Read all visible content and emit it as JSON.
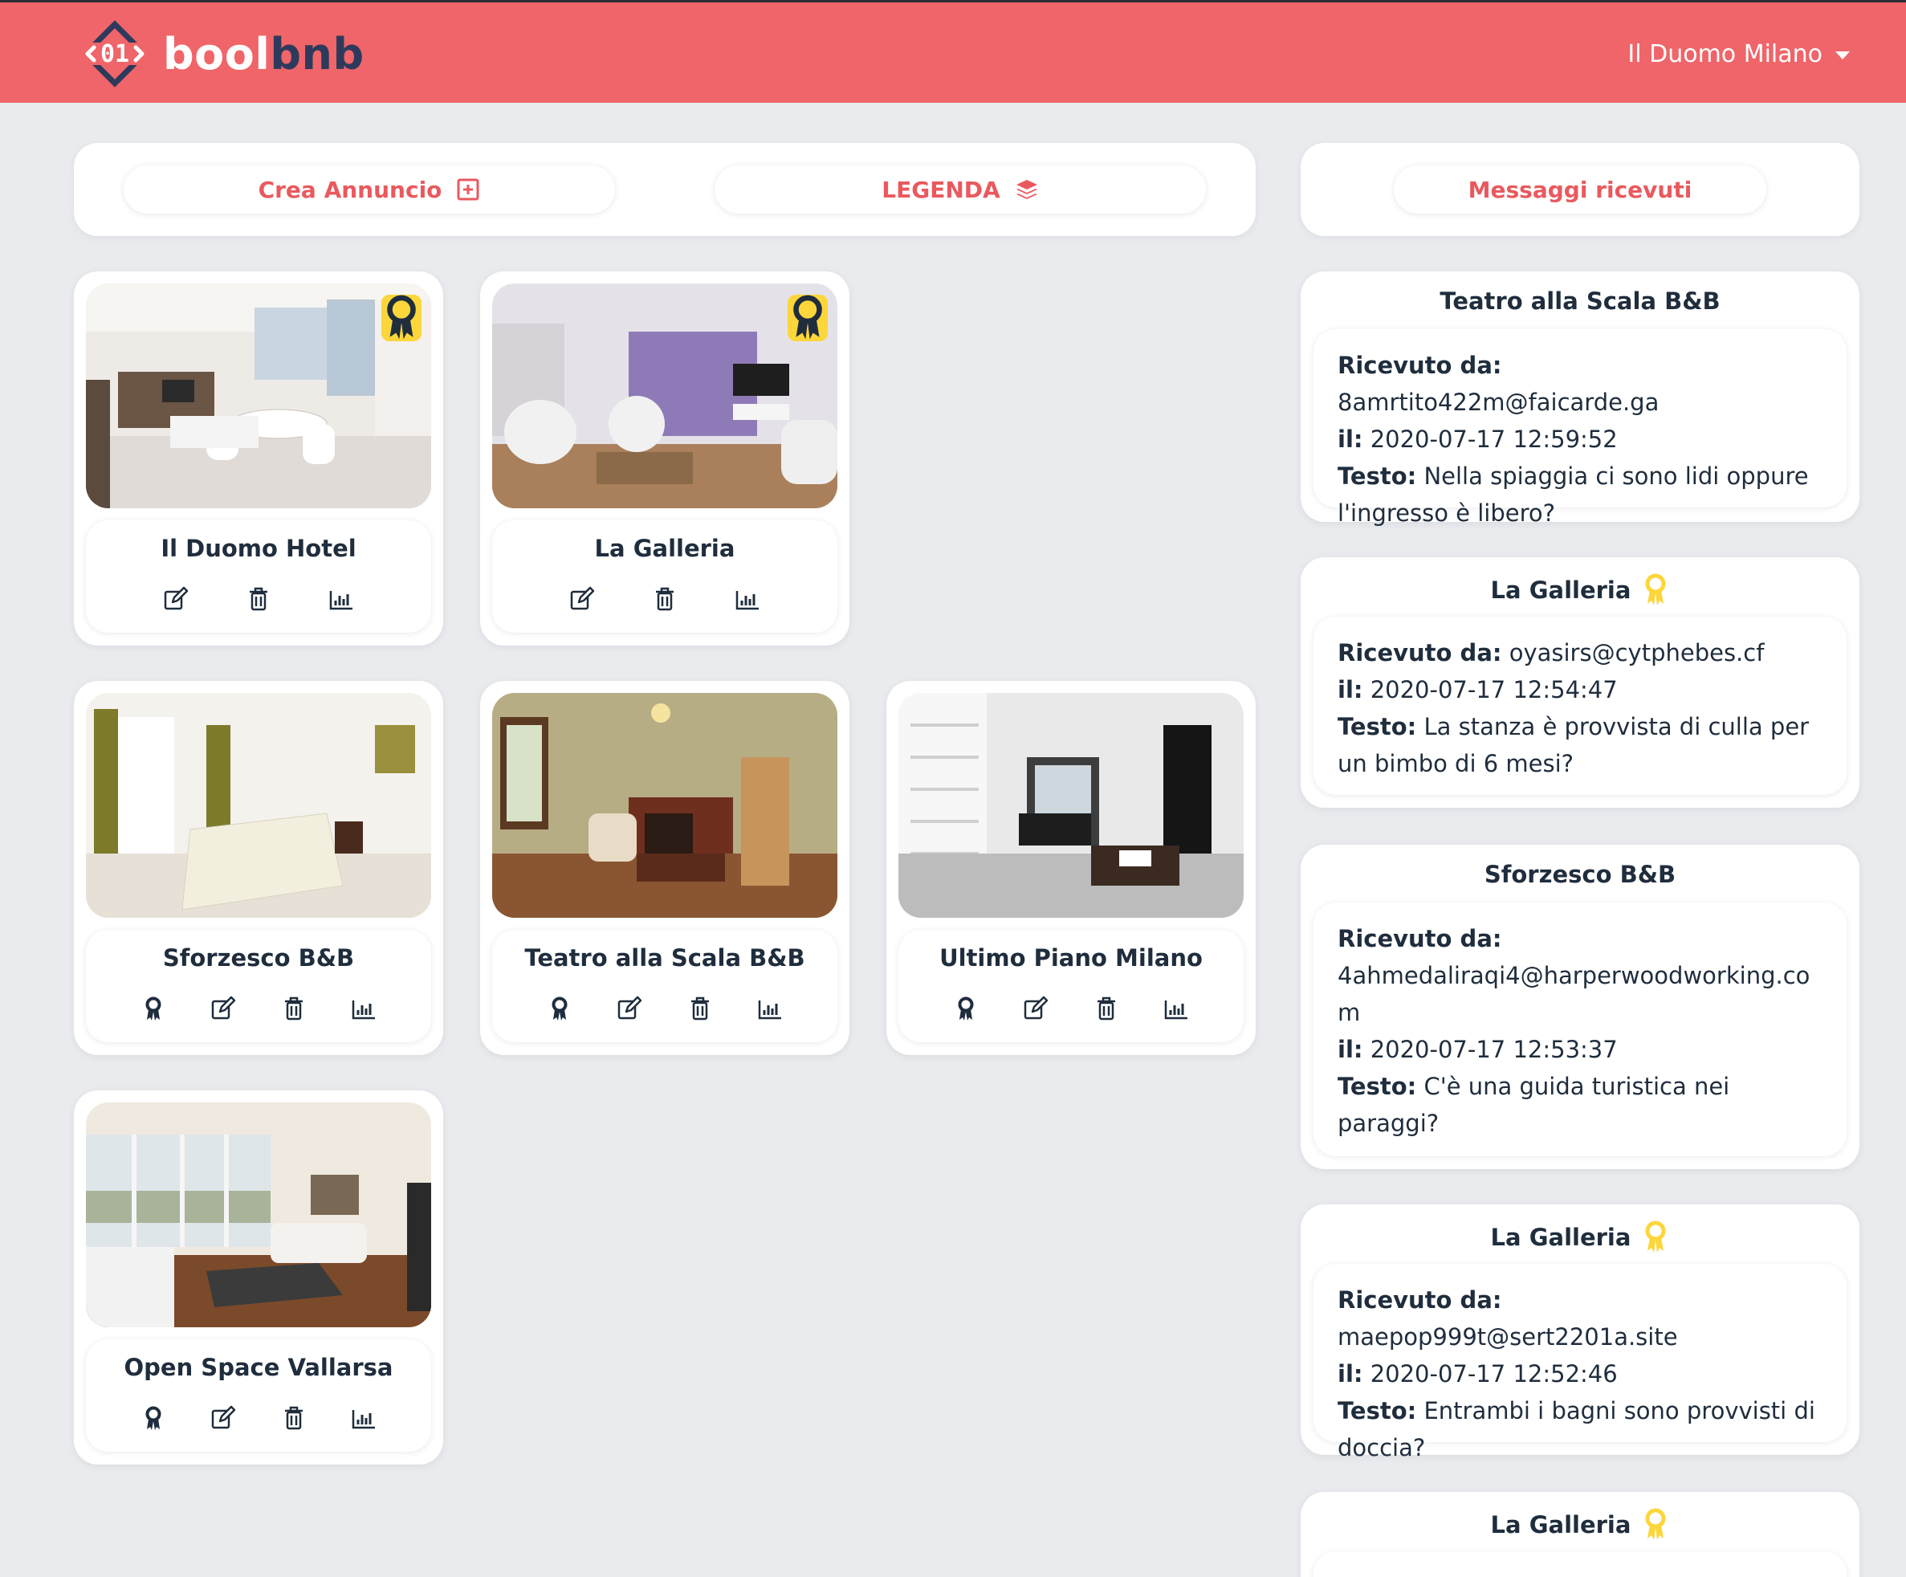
{
  "header": {
    "logo_mark": "01",
    "logo_part1": "bool",
    "logo_part2": "bnb",
    "user_name": "Il Duomo Milano",
    "bg_color": "#ef6569"
  },
  "toolbar": {
    "create_label": "Crea Annuncio",
    "create_icon": "plus-square-icon",
    "legend_label": "LEGENDA",
    "legend_icon": "layers-icon",
    "messages_label": "Messaggi ricevuti"
  },
  "listings": [
    {
      "title": "Il Duomo Hotel",
      "sponsored": true
    },
    {
      "title": "La Galleria",
      "sponsored": true
    },
    {
      "title": "Sforzesco B&B",
      "sponsored": false
    },
    {
      "title": "Teatro alla Scala B&B",
      "sponsored": false
    },
    {
      "title": "Ultimo Piano Milano",
      "sponsored": false
    },
    {
      "title": "Open Space Vallarsa",
      "sponsored": false
    }
  ],
  "messages": [
    {
      "apartment": "Teatro alla Scala B&B",
      "sponsored": false,
      "from_label": "Ricevuto da:",
      "from": "8amrtito422m@faicarde.ga",
      "date_label": "il:",
      "date": "2020-07-17 12:59:52",
      "text_label": "Testo:",
      "text": "Nella spiaggia ci sono lidi oppure l'ingresso è libero?"
    },
    {
      "apartment": "La Galleria",
      "sponsored": true,
      "from_label": "Ricevuto da:",
      "from": "oyasirs@cytphebes.cf",
      "date_label": "il:",
      "date": "2020-07-17 12:54:47",
      "text_label": "Testo:",
      "text": "La stanza è provvista di culla per un bimbo di 6 mesi?"
    },
    {
      "apartment": "Sforzesco B&B",
      "sponsored": false,
      "from_label": "Ricevuto da:",
      "from": "4ahmedaliraqi4@harperwoodworking.com",
      "date_label": "il:",
      "date": "2020-07-17 12:53:37",
      "text_label": "Testo:",
      "text": "C'è una guida turistica nei paraggi?"
    },
    {
      "apartment": "La Galleria",
      "sponsored": true,
      "from_label": "Ricevuto da:",
      "from": "maepop999t@sert2201a.site",
      "date_label": "il:",
      "date": "2020-07-17 12:52:46",
      "text_label": "Testo:",
      "text": "Entrambi i bagni sono provvisti di doccia?"
    },
    {
      "apartment": "La Galleria",
      "sponsored": true
    }
  ]
}
